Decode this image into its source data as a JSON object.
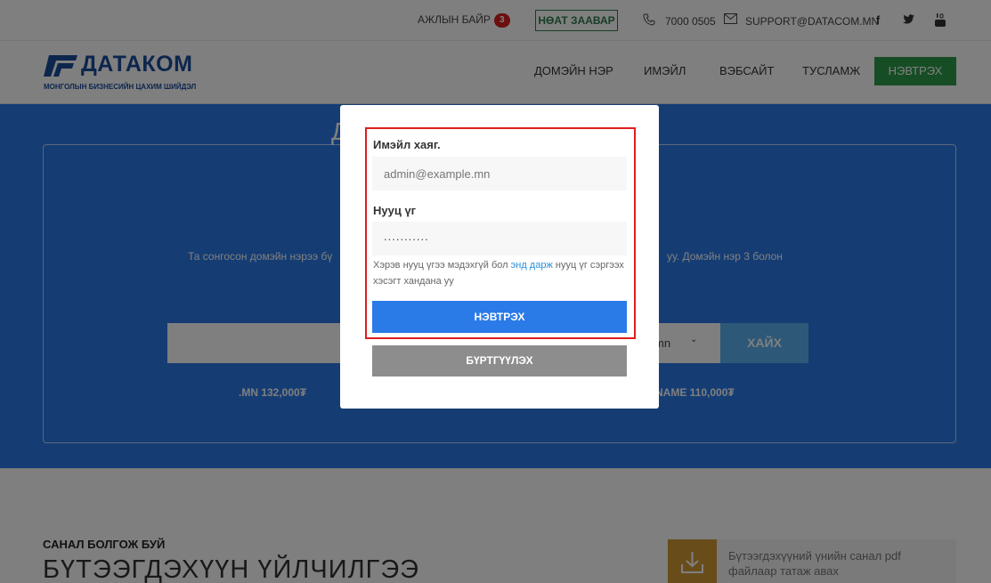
{
  "topbar": {
    "jobs_label": "АЖЛЫН БАЙР",
    "jobs_count": "3",
    "guide_label": "НӨАТ ЗААВАР",
    "phone": "7000 0505",
    "email": "SUPPORT@DATACOM.MN",
    "social_icons": [
      "facebook-icon",
      "twitter-icon",
      "youtube-icon"
    ]
  },
  "brand": {
    "name": "ДАТАКОМ",
    "tagline": "МОНГОЛЫН БИЗНЕСИЙН ЦАХИМ ШИЙДЭЛ",
    "color": "#1b4c9b"
  },
  "nav": {
    "items": [
      "ДОМЭЙН НЭР",
      "ИМЭЙЛ",
      "ВЭБСАЙТ",
      "ТУСЛАМЖ"
    ],
    "login_label": "НЭВТРЭХ",
    "login_color": "#2e9a4b"
  },
  "hero": {
    "title_fragment": "Д",
    "desc_left": "Та сонгосон домэйн нэрээ бү",
    "desc_right": "уу. Домэйн нэр 3 болон",
    "tld_selected": "mn",
    "search_label": "ХАЙХ",
    "price_mn": ".MN 132,000₮",
    "price_name": "NAME 110,000₮",
    "color": "#2a7ae8"
  },
  "offers": {
    "subtitle": "САНАЛ БОЛГОЖ БУЙ",
    "title": "БҮТЭЭГДЭХҮҮН ҮЙЛЧИЛГЭЭ",
    "pdf_text": "Бүтээгдэхүүний үнийн санал pdf файлаар татаж авах"
  },
  "modal": {
    "email_label": "Имэйл хаяг.",
    "email_placeholder": "admin@example.mn",
    "password_label": "Нууц үг",
    "password_value": "...........",
    "help_before": "Хэрэв нууц үгээ мэдэхгүй бол ",
    "help_link": "энд дарж",
    "help_after": " нууц үг сэргээх хэсэгт хандана уу",
    "login_button": "НЭВТРЭХ",
    "register_button": "БҮРТГҮҮЛЭХ",
    "highlight_color": "#e01d1d"
  }
}
